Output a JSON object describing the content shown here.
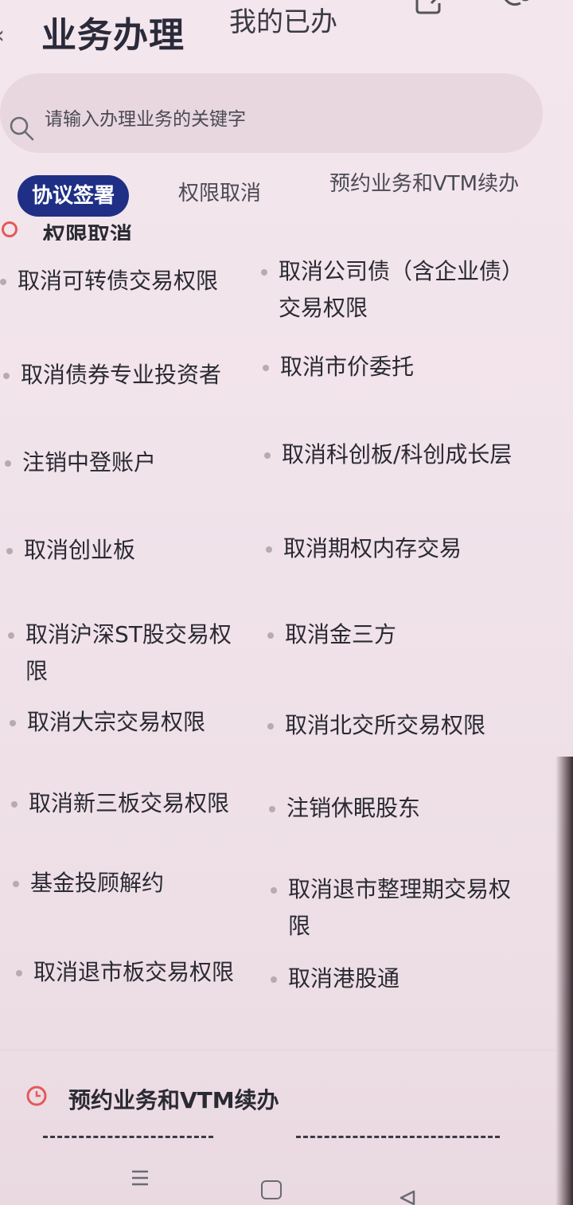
{
  "header": {
    "title": "业务办理",
    "second_tab": "我的已办"
  },
  "search": {
    "placeholder": "请输入办理业务的关键字"
  },
  "tabs": [
    {
      "label": "协议签署",
      "active": true
    },
    {
      "label": "权限取消",
      "active": false
    },
    {
      "label": "预约业务和VTM续办",
      "active": false
    }
  ],
  "section": {
    "title": "权限取消"
  },
  "items": [
    {
      "label": "取消可转债交易权限"
    },
    {
      "label": "取消公司债（含企业债）交易权限"
    },
    {
      "label": "取消债券专业投资者"
    },
    {
      "label": "取消市价委托"
    },
    {
      "label": "注销中登账户"
    },
    {
      "label": "取消科创板/科创成长层"
    },
    {
      "label": "取消创业板"
    },
    {
      "label": "取消期权内存交易"
    },
    {
      "label": "取消沪深ST股交易权限"
    },
    {
      "label": "取消金三方"
    },
    {
      "label": "取消大宗交易权限"
    },
    {
      "label": "取消北交所交易权限"
    },
    {
      "label": "取消新三板交易权限"
    },
    {
      "label": "注销休眠股东"
    },
    {
      "label": "基金投顾解约"
    },
    {
      "label": "取消退市整理期交易权限"
    },
    {
      "label": "取消退市板交易权限"
    },
    {
      "label": "取消港股通"
    }
  ],
  "section2": {
    "title": "预约业务和VTM续办"
  },
  "icons": {
    "section_icon": "clock-icon",
    "search": "search-icon",
    "edit": "edit-icon",
    "mic": "mic-icon"
  },
  "colors": {
    "accent": "#1f2f86",
    "section_icon": "#e25a5a",
    "background": "#f1e3ea"
  }
}
